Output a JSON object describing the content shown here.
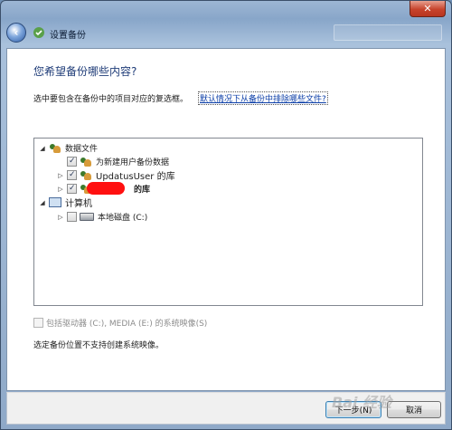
{
  "window": {
    "title": "设置备份",
    "close_label": "✕"
  },
  "content": {
    "heading": "您希望备份哪些内容?",
    "instruction": "选中要包含在备份中的项目对应的复选框。",
    "help_link": "默认情况下从备份中排除哪些文件?",
    "tree": {
      "data_files": "数据文件",
      "new_users": "为新建用户备份数据",
      "updatus_library": "UpdatusUser 的库",
      "other_library": "的库",
      "computer": "计算机",
      "local_disk": "本地磁盘 (C:)"
    },
    "system_image_option": "包括驱动器 (C:), MEDIA (E:) 的系统映像(S)",
    "system_image_note": "选定备份位置不支持创建系统映像。"
  },
  "footer": {
    "next_button": "下一步(N)",
    "cancel_button": "取消"
  },
  "watermark": "Bai 经验"
}
